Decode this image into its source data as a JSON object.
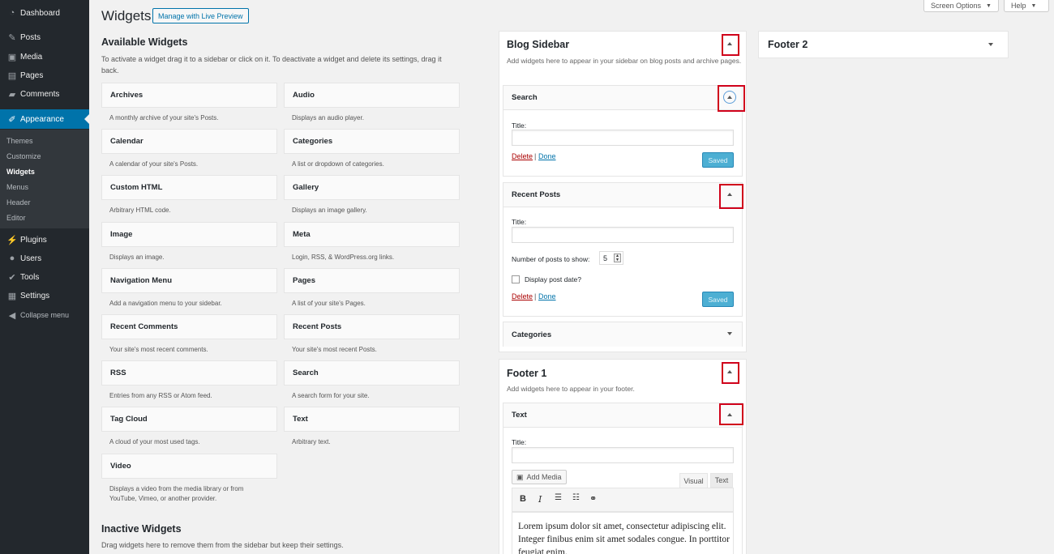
{
  "menu": {
    "items": [
      {
        "label": "Dashboard",
        "icon": "dashboard-icon",
        "glyph": "◔"
      },
      {
        "label": "Posts",
        "icon": "pin-icon",
        "glyph": "✎"
      },
      {
        "label": "Media",
        "icon": "media-icon",
        "glyph": "▣"
      },
      {
        "label": "Pages",
        "icon": "pages-icon",
        "glyph": "▤"
      },
      {
        "label": "Comments",
        "icon": "comments-icon",
        "glyph": "▰"
      },
      {
        "label": "Appearance",
        "icon": "brush-icon",
        "glyph": "✐"
      },
      {
        "label": "Plugins",
        "icon": "plugin-icon",
        "glyph": "⚡"
      },
      {
        "label": "Users",
        "icon": "users-icon",
        "glyph": "●"
      },
      {
        "label": "Tools",
        "icon": "wrench-icon",
        "glyph": "✔"
      },
      {
        "label": "Settings",
        "icon": "settings-icon",
        "glyph": "▦"
      },
      {
        "label": "Collapse menu",
        "icon": "collapse-icon",
        "glyph": "◀"
      }
    ],
    "submenu": [
      "Themes",
      "Customize",
      "Widgets",
      "Menus",
      "Header",
      "Editor"
    ]
  },
  "header": {
    "title": "Widgets",
    "live_preview": "Manage with Live Preview",
    "screen_options": "Screen Options",
    "help": "Help"
  },
  "available": {
    "title": "Available Widgets",
    "description": "To activate a widget drag it to a sidebar or click on it. To deactivate a widget and delete its settings, drag it back.",
    "widgets": [
      {
        "name": "Archives",
        "desc": "A monthly archive of your site's Posts."
      },
      {
        "name": "Audio",
        "desc": "Displays an audio player."
      },
      {
        "name": "Calendar",
        "desc": "A calendar of your site's Posts."
      },
      {
        "name": "Categories",
        "desc": "A list or dropdown of categories."
      },
      {
        "name": "Custom HTML",
        "desc": "Arbitrary HTML code."
      },
      {
        "name": "Gallery",
        "desc": "Displays an image gallery."
      },
      {
        "name": "Image",
        "desc": "Displays an image."
      },
      {
        "name": "Meta",
        "desc": "Login, RSS, & WordPress.org links."
      },
      {
        "name": "Navigation Menu",
        "desc": "Add a navigation menu to your sidebar."
      },
      {
        "name": "Pages",
        "desc": "A list of your site's Pages."
      },
      {
        "name": "Recent Comments",
        "desc": "Your site's most recent comments."
      },
      {
        "name": "Recent Posts",
        "desc": "Your site's most recent Posts."
      },
      {
        "name": "RSS",
        "desc": "Entries from any RSS or Atom feed."
      },
      {
        "name": "Search",
        "desc": "A search form for your site."
      },
      {
        "name": "Tag Cloud",
        "desc": "A cloud of your most used tags."
      },
      {
        "name": "Text",
        "desc": "Arbitrary text."
      },
      {
        "name": "Video",
        "desc": "Displays a video from the media library or from YouTube, Vimeo, or another provider."
      }
    ]
  },
  "inactive": {
    "title": "Inactive Widgets",
    "description": "Drag widgets here to remove them from the sidebar but keep their settings."
  },
  "blog_sidebar": {
    "title": "Blog Sidebar",
    "description": "Add widgets here to appear in your sidebar on blog posts and archive pages.",
    "search_widget": {
      "title": "Search",
      "field_label": "Title:",
      "field_value": "",
      "delete": "Delete",
      "sep": "|",
      "done": "Done",
      "saved": "Saved"
    },
    "recent_widget": {
      "title": "Recent Posts",
      "field_label": "Title:",
      "field_value": "",
      "num_label": "Number of posts to show:",
      "num_value": "5",
      "checkbox_label": "Display post date?",
      "checkbox_checked": false,
      "delete": "Delete",
      "sep": "|",
      "done": "Done",
      "saved": "Saved"
    },
    "categories_widget": {
      "title": "Categories"
    }
  },
  "footer1": {
    "title": "Footer 1",
    "description": "Add widgets here to appear in your footer.",
    "text_widget": {
      "title": "Text",
      "field_label": "Title:",
      "field_value": "",
      "add_media": "Add Media",
      "tab_visual": "Visual",
      "tab_text": "Text",
      "content": "Lorem ipsum dolor sit amet, consectetur adipiscing elit. Integer finibus enim sit amet sodales congue. In porttitor feugiat enim."
    }
  },
  "footer2": {
    "title": "Footer 2"
  },
  "colors": {
    "accent": "#0073aa",
    "menu_bg": "#23282d",
    "highlight": "#d0021b"
  }
}
